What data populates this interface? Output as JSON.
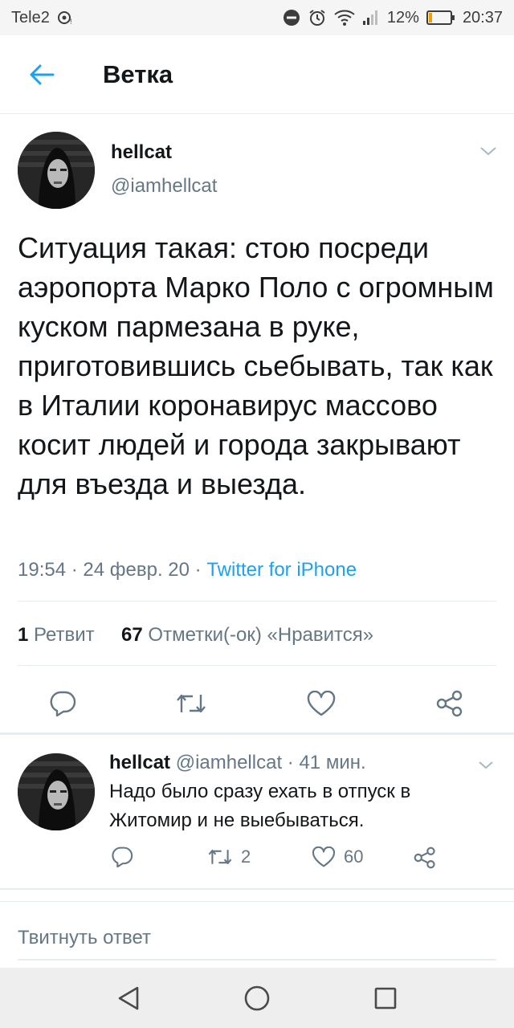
{
  "status_bar": {
    "carrier": "Tele2",
    "battery_percent": "12%",
    "time": "20:37",
    "icons": [
      "eye-icon",
      "do-not-disturb-icon",
      "alarm-icon",
      "wifi-icon",
      "signal-icon",
      "battery-icon"
    ]
  },
  "header": {
    "title": "Ветка",
    "back_icon": "arrow-left-icon"
  },
  "main_tweet": {
    "author_name": "hellcat",
    "author_handle": "@iamhellcat",
    "text": "Ситуация такая: стою посреди аэропорта Марко Поло с огромным куском пармезана в руке, приготовившись сьебывать, так как в Италии коронавирус массово косит людей и города закрывают для въезда и выезда.",
    "meta_time": "19:54 · 24 февр. 20 · ",
    "meta_source": "Twitter for iPhone",
    "retweets_count": "1",
    "retweets_label": "Ретвит",
    "likes_count": "67",
    "likes_label": "Отметки(-ок) «Нравится»"
  },
  "reply_tweet": {
    "author_name": "hellcat",
    "author_handle": "@iamhellcat",
    "time_ago": " · 41 мин.",
    "text": "Надо было сразу ехать в отпуск в Житомир и не выебываться.",
    "retweet_count": "2",
    "like_count": "60"
  },
  "composer": {
    "placeholder": "Твитнуть ответ"
  },
  "colors": {
    "accent": "#1da1f2",
    "secondary_text": "#657786",
    "primary_text": "#14171a",
    "divider": "#e6ecf0"
  }
}
